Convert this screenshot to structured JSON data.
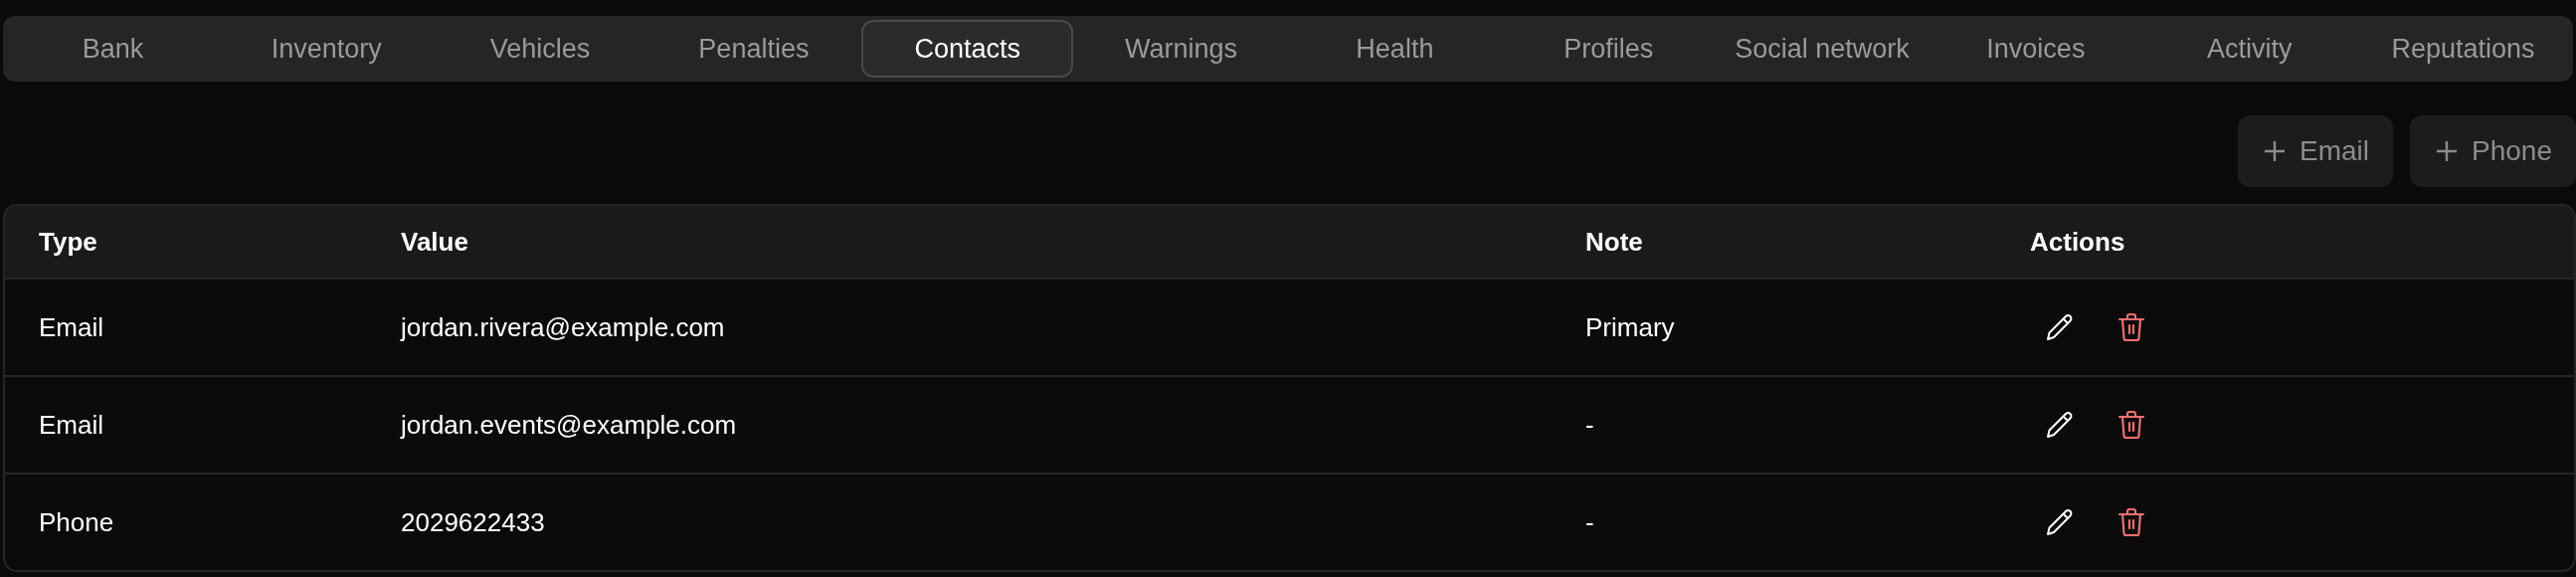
{
  "tabs": [
    {
      "label": "Bank",
      "selected": false
    },
    {
      "label": "Inventory",
      "selected": false
    },
    {
      "label": "Vehicles",
      "selected": false
    },
    {
      "label": "Penalties",
      "selected": false
    },
    {
      "label": "Contacts",
      "selected": true
    },
    {
      "label": "Warnings",
      "selected": false
    },
    {
      "label": "Health",
      "selected": false
    },
    {
      "label": "Profiles",
      "selected": false
    },
    {
      "label": "Social network",
      "selected": false
    },
    {
      "label": "Invoices",
      "selected": false
    },
    {
      "label": "Activity",
      "selected": false
    },
    {
      "label": "Reputations",
      "selected": false
    }
  ],
  "add_buttons": [
    {
      "label": "Email"
    },
    {
      "label": "Phone"
    }
  ],
  "table": {
    "columns": [
      "Type",
      "Value",
      "Note",
      "Actions"
    ],
    "rows": [
      {
        "type": "Email",
        "value": "jordan.rivera@example.com",
        "note": "Primary"
      },
      {
        "type": "Email",
        "value": "jordan.events@example.com",
        "note": "-"
      },
      {
        "type": "Phone",
        "value": "2029622433",
        "note": "-"
      }
    ]
  }
}
